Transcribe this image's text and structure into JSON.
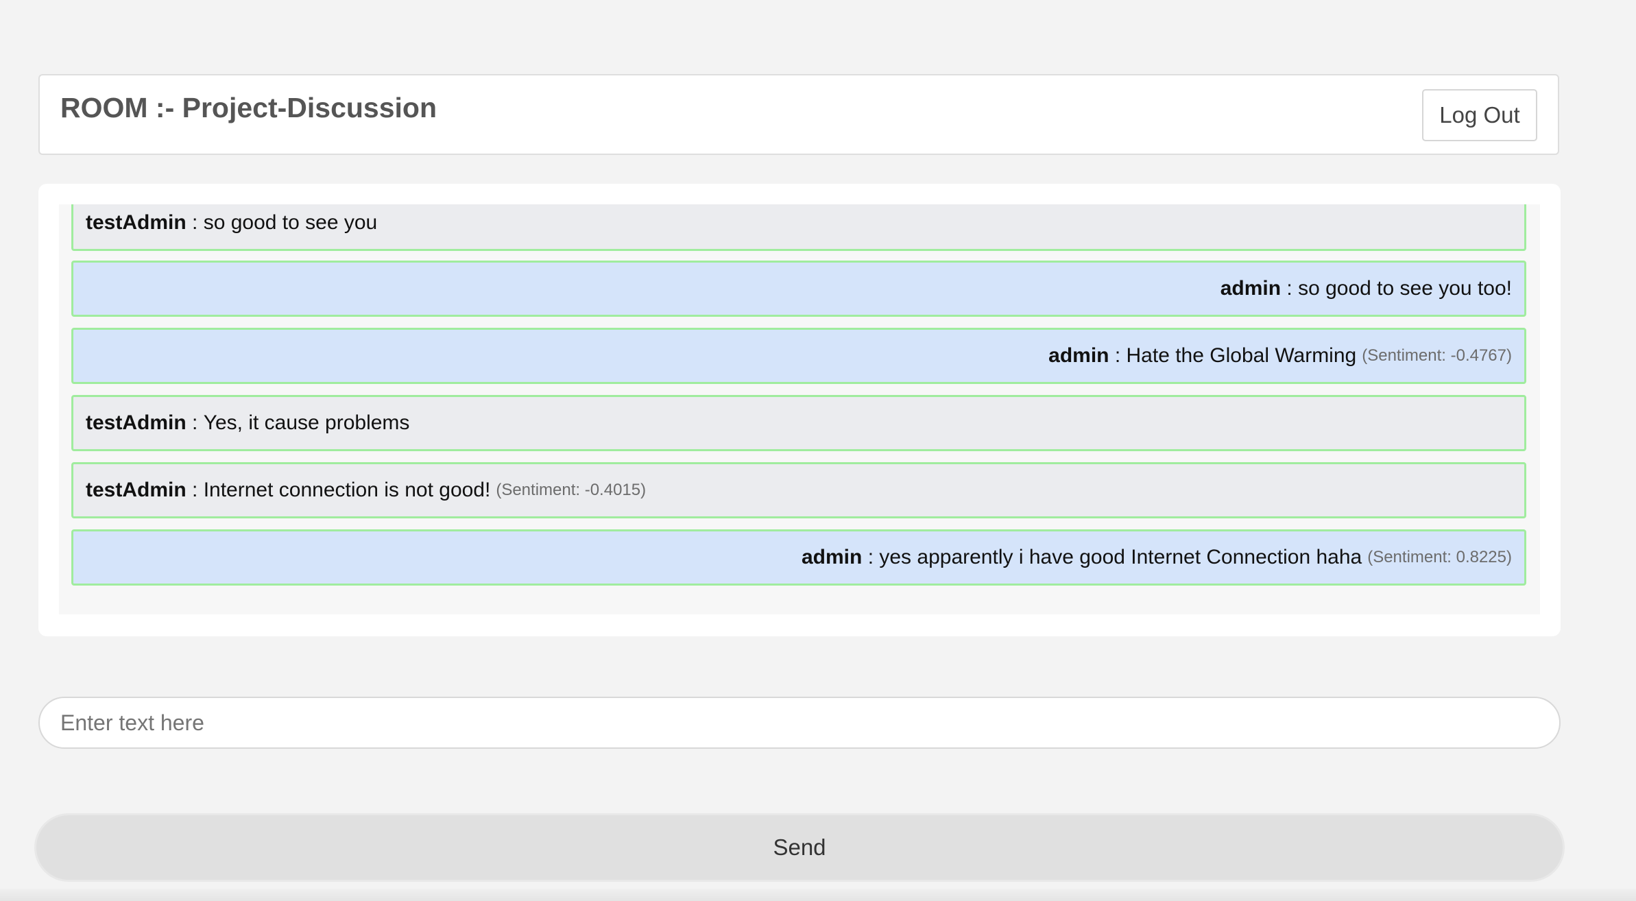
{
  "header": {
    "room_title": "ROOM :- Project-Discussion",
    "logout_label": "Log Out"
  },
  "messages": [
    {
      "sender": "testAdmin",
      "separator": " : ",
      "text": "so good to see you",
      "sentiment": "",
      "side": "other"
    },
    {
      "sender": "admin",
      "separator": " : ",
      "text": "so good to see you too!",
      "sentiment": "",
      "side": "self"
    },
    {
      "sender": "admin",
      "separator": " : ",
      "text": "Hate the Global Warming",
      "sentiment": "(Sentiment: -0.4767)",
      "side": "self"
    },
    {
      "sender": "testAdmin",
      "separator": " : ",
      "text": "Yes, it cause problems",
      "sentiment": "",
      "side": "other"
    },
    {
      "sender": "testAdmin",
      "separator": " : ",
      "text": "Internet connection is not good!",
      "sentiment": "(Sentiment: -0.4015)",
      "side": "other"
    },
    {
      "sender": "admin",
      "separator": " : ",
      "text": "yes apparently i have good Internet Connection haha",
      "sentiment": "(Sentiment: 0.8225)",
      "side": "self"
    }
  ],
  "composer": {
    "placeholder": "Enter text here",
    "value": "",
    "send_label": "Send"
  },
  "colors": {
    "page_background": "#f3f3f3",
    "other_message_background": "#ebecef",
    "self_message_background": "#d5e4fa",
    "message_border": "#a0ec9e"
  }
}
